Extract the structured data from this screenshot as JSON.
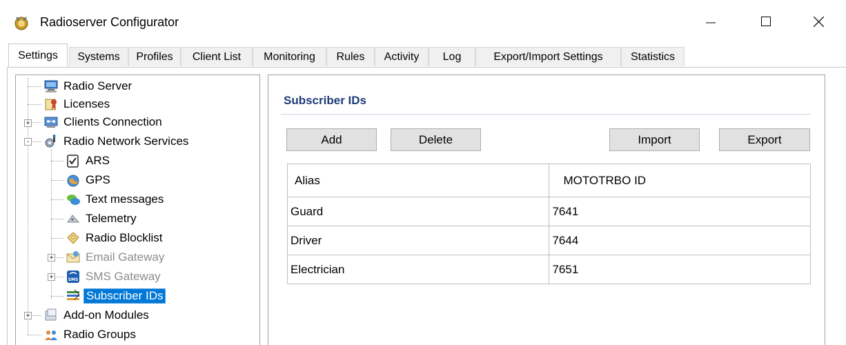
{
  "window": {
    "title": "Radioserver Configurator",
    "icon": "app-badge-icon",
    "controls": [
      "minimize-icon",
      "maximize-icon",
      "close-icon"
    ]
  },
  "tabs": [
    {
      "label": "Settings",
      "active": true
    },
    {
      "label": "Systems"
    },
    {
      "label": "Profiles"
    },
    {
      "label": "Client List"
    },
    {
      "label": "Monitoring"
    },
    {
      "label": "Rules"
    },
    {
      "label": "Activity"
    },
    {
      "label": "Log"
    },
    {
      "label": "Export/Import Settings"
    },
    {
      "label": "Statistics"
    }
  ],
  "tree": {
    "items": [
      {
        "label": "Radio Server",
        "icon": "server-icon"
      },
      {
        "label": "Licenses",
        "icon": "license-icon"
      },
      {
        "label": "Clients Connection",
        "icon": "network-icon",
        "expander": "+"
      },
      {
        "label": "Radio Network Services",
        "icon": "services-gear-icon",
        "expander": "-"
      },
      {
        "label": "ARS",
        "icon": "ars-checklist-icon"
      },
      {
        "label": "GPS",
        "icon": "gps-globe-icon"
      },
      {
        "label": "Text messages",
        "icon": "text-messages-icon"
      },
      {
        "label": "Telemetry",
        "icon": "telemetry-icon"
      },
      {
        "label": "Radio Blocklist",
        "icon": "blocklist-icon"
      },
      {
        "label": "Email Gateway",
        "icon": "email-icon",
        "expander": "+",
        "disabled": true
      },
      {
        "label": "SMS Gateway",
        "icon": "sms-icon",
        "expander": "+",
        "disabled": true
      },
      {
        "label": "Subscriber IDs",
        "icon": "subscriber-ids-icon",
        "selected": true
      },
      {
        "label": "Add-on Modules",
        "icon": "modules-icon",
        "expander": "+"
      },
      {
        "label": "Radio Groups",
        "icon": "radio-groups-icon"
      }
    ]
  },
  "panel": {
    "title": "Subscriber IDs",
    "buttons": {
      "add": "Add",
      "delete": "Delete",
      "import": "Import",
      "export": "Export"
    },
    "table": {
      "columns": [
        "Alias",
        "MOTOTRBO ID"
      ],
      "rows": [
        [
          "Guard",
          "7641"
        ],
        [
          "Driver",
          "7644"
        ],
        [
          "Electrician",
          "7651"
        ]
      ]
    }
  },
  "colors": {
    "selection": "#0078d7",
    "panel_title": "#1e3a78",
    "disabled_text": "#8c8c8c"
  }
}
